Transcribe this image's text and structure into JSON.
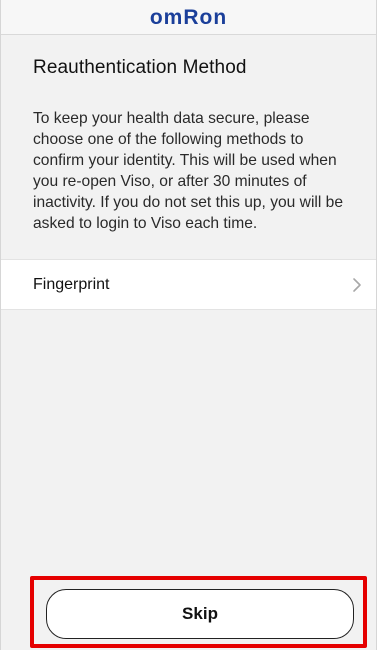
{
  "header": {
    "logo_text": "omRon"
  },
  "main": {
    "title": "Reauthentication Method",
    "description": "To keep your health data secure, please choose one of the following methods to confirm your identity. This will be used when you re-open Viso, or after 30 minutes of inactivity. If you do not set this up, you will be asked to login to Viso each time.",
    "options": [
      {
        "label": "Fingerprint",
        "icon": "chevron-right-icon"
      }
    ]
  },
  "footer": {
    "skip_label": "Skip"
  },
  "colors": {
    "brand": "#1b3f9a",
    "highlight": "#e50000",
    "background": "#f2f2f2"
  }
}
